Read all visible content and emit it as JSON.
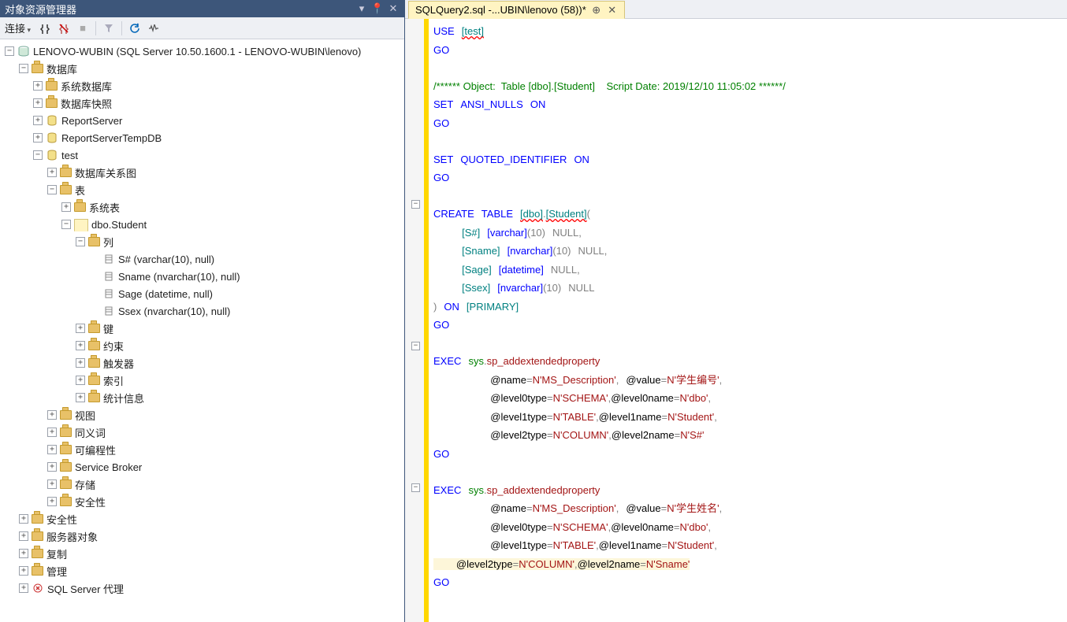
{
  "panel_title": "对象资源管理器",
  "toolbar_label": "连接",
  "tab_label": "SQLQuery2.sql -...UBIN\\lenovo (58))*",
  "tree": {
    "server": "LENOVO-WUBIN (SQL Server 10.50.1600.1 - LENOVO-WUBIN\\lenovo)",
    "databases": "数据库",
    "sysdb": "系统数据库",
    "snapshot": "数据库快照",
    "reportserver": "ReportServer",
    "reportservertemp": "ReportServerTempDB",
    "test": "test",
    "diagrams": "数据库关系图",
    "tables": "表",
    "systables": "系统表",
    "dbo_student": "dbo.Student",
    "columns": "列",
    "col_s": "S# (varchar(10), null)",
    "col_sname": "Sname (nvarchar(10), null)",
    "col_sage": "Sage (datetime, null)",
    "col_ssex": "Ssex (nvarchar(10), null)",
    "keys": "键",
    "constraints": "约束",
    "triggers": "触发器",
    "indexes": "索引",
    "stats": "统计信息",
    "views": "视图",
    "synonyms": "同义词",
    "programmability": "可编程性",
    "sb": "Service Broker",
    "storage": "存储",
    "db_security": "安全性",
    "security": "安全性",
    "serverobj": "服务器对象",
    "replication": "复制",
    "management": "管理",
    "agent": "SQL Server 代理"
  },
  "sql": {
    "use": "USE",
    "go": "GO",
    "test": "[test]",
    "comment": "/****** Object:  Table [dbo].[Student]    Script Date: 2019/12/10 11:05:02 ******/",
    "set1": "SET",
    "ansi": "ANSI_NULLS",
    "on": "ON",
    "qid": "QUOTED_IDENTIFIER",
    "create": "CREATE",
    "table_kw": "TABLE",
    "dbo": "[dbo]",
    "student": "[Student]",
    "s": "[S#]",
    "varchar": "[varchar]",
    "ten": "(10)",
    "null": "NULL",
    "sname": "[Sname]",
    "nvarchar": "[nvarchar]",
    "sage": "[Sage]",
    "datetime": "[datetime]",
    "ssex": "[Ssex]",
    "onkw": "ON",
    "primary": "[PRIMARY]",
    "exec": "EXEC",
    "sys": "sys",
    "sp": "sp_addextendedproperty",
    "name": "@name",
    "eq": "=",
    "N": "N",
    "msdesc": "'MS_Description'",
    "value": "@value",
    "stuid": "'学生编号'",
    "stuname": "'学生姓名'",
    "l0t": "@level0type",
    "schema": "'SCHEMA'",
    "l0n": "@level0name",
    "dbo_s": "'dbo'",
    "l1t": "@level1type",
    "tab": "'TABLE'",
    "l1n": "@level1name",
    "student_s": "'Student'",
    "l2t": "@level2type",
    "col": "'COLUMN'",
    "l2n": "@level2name",
    "scol": "'S#'",
    "snamecol": "'Sname'"
  }
}
